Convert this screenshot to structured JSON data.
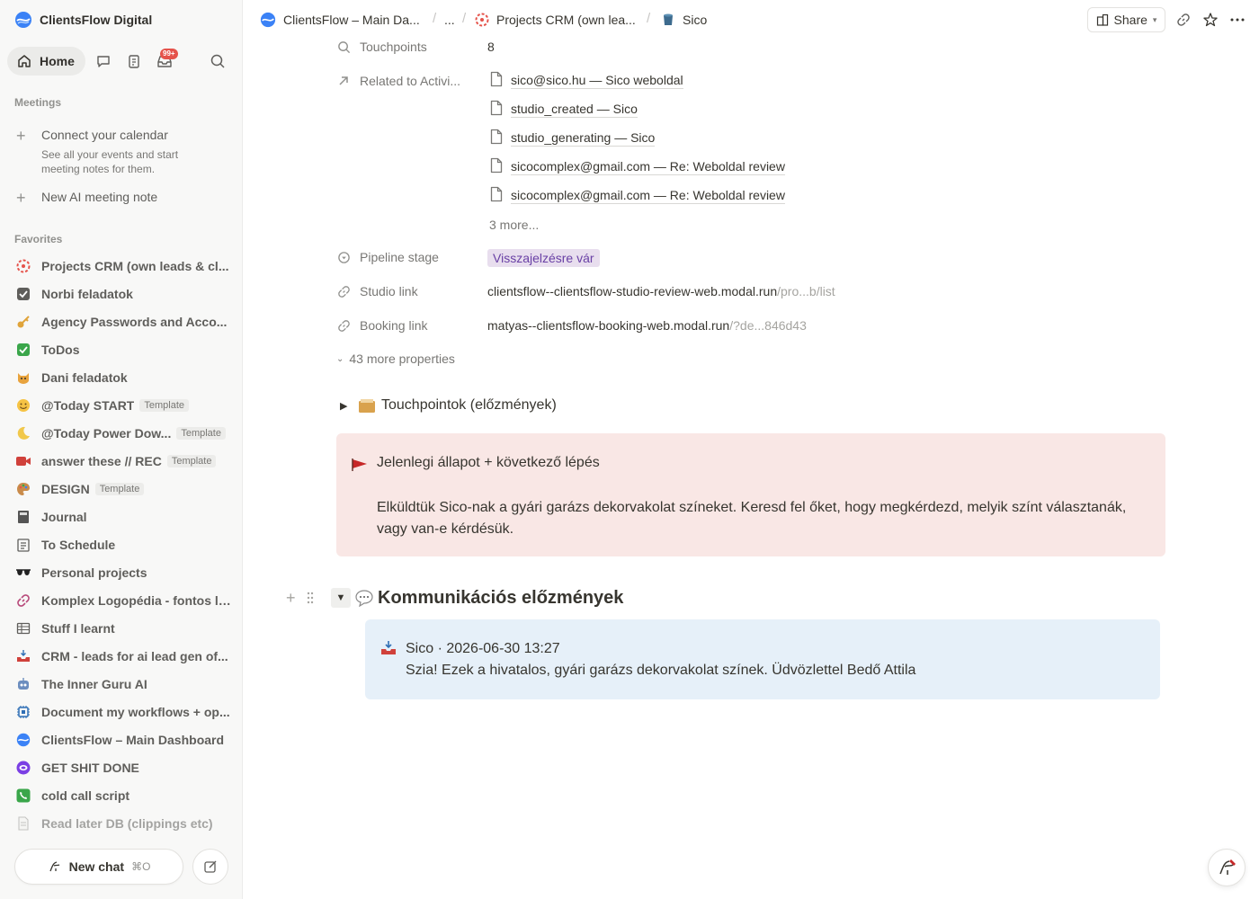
{
  "workspace": {
    "name": "ClientsFlow Digital"
  },
  "nav": {
    "home_label": "Home",
    "inbox_badge": "99+"
  },
  "meetings": {
    "section_label": "Meetings",
    "connect_title": "Connect your calendar",
    "connect_desc": "See all your events and start meeting notes for them.",
    "new_note_label": "New AI meeting note"
  },
  "favorites": {
    "section_label": "Favorites",
    "items": [
      {
        "label": "Projects CRM (own leads & cl...",
        "icon": "crm-logo-icon"
      },
      {
        "label": "Norbi feladatok",
        "icon": "checkbox-icon"
      },
      {
        "label": "Agency Passwords and Acco...",
        "icon": "key-icon"
      },
      {
        "label": "ToDos",
        "icon": "check-mark-icon"
      },
      {
        "label": "Dani feladatok",
        "icon": "cat-icon"
      },
      {
        "label": "@Today START",
        "icon": "smile-icon",
        "template": "Template"
      },
      {
        "label": "@Today Power Dow...",
        "icon": "moon-icon",
        "template": "Template"
      },
      {
        "label": "answer these // REC",
        "icon": "video-camera-icon",
        "template": "Template"
      },
      {
        "label": "DESIGN",
        "icon": "palette-icon",
        "template": "Template"
      },
      {
        "label": "Journal",
        "icon": "notebook-icon"
      },
      {
        "label": "To Schedule",
        "icon": "calendar-list-icon"
      },
      {
        "label": "Personal projects",
        "icon": "sunglasses-icon"
      },
      {
        "label": "Komplex Logopédia - fontos li...",
        "icon": "link-icon"
      },
      {
        "label": "Stuff I learnt",
        "icon": "table-icon"
      },
      {
        "label": "CRM - leads for ai lead gen of...",
        "icon": "inbox-tray-icon"
      },
      {
        "label": "The Inner Guru AI",
        "icon": "robot-icon"
      },
      {
        "label": "Document my workflows + op...",
        "icon": "chip-icon"
      },
      {
        "label": "ClientsFlow – Main Dashboard",
        "icon": "clientsflow-logo-icon"
      },
      {
        "label": "GET SHIT DONE",
        "icon": "purple-app-icon"
      },
      {
        "label": "cold call script",
        "icon": "phone-icon"
      },
      {
        "label": "Read later DB (clippings etc)",
        "icon": "page-icon"
      }
    ]
  },
  "bottom": {
    "new_chat_label": "New chat",
    "new_chat_shortcut": "⌘O"
  },
  "breadcrumbs": {
    "root": "ClientsFlow – Main Da...",
    "ellipsis": "...",
    "parent": "Projects CRM (own lea...",
    "current": "Sico"
  },
  "topbar": {
    "share_label": "Share"
  },
  "properties": {
    "touchpoints": {
      "label": "Touchpoints",
      "value": "8"
    },
    "related": {
      "label": "Related to Activi...",
      "items": [
        "sico@sico.hu — Sico weboldal",
        "studio_created — Sico",
        "studio_generating — Sico",
        "sicocomplex@gmail.com — Re: Weboldal review",
        "sicocomplex@gmail.com — Re: Weboldal review"
      ],
      "more": "3 more..."
    },
    "pipeline": {
      "label": "Pipeline stage",
      "value": "Visszajelzésre vár"
    },
    "studio": {
      "label": "Studio link",
      "main": "clientsflow--clientsflow-studio-review-web.modal.run",
      "dim": "/pro...b/list"
    },
    "booking": {
      "label": "Booking link",
      "main": "matyas--clientsflow-booking-web.modal.run",
      "dim": "/?de...846d43"
    },
    "more_props": "43 more properties"
  },
  "toggle_block": {
    "title": "Touchpointok (előzmények)"
  },
  "callout": {
    "title": "Jelenlegi állapot + következő lépés",
    "body": "Elküldtük Sico-nak a gyári garázs dekorvakolat színeket. Keresd fel őket, hogy megkérdezd, melyik színt választanák, vagy van-e kérdésük."
  },
  "comms": {
    "heading": "Kommunikációs előzmények",
    "message_header": "Sico · 2026-06-30 13:27",
    "message_body": "Szia! Ezek a hivatalos, gyári garázs dekorvakolat színek. Üdvözlettel Bedő Attila"
  },
  "colors": {
    "callout_bg": "#f9e7e5",
    "message_bg": "#e6f0f9",
    "tag_bg": "#e8deee",
    "badge": "#e5534b"
  }
}
